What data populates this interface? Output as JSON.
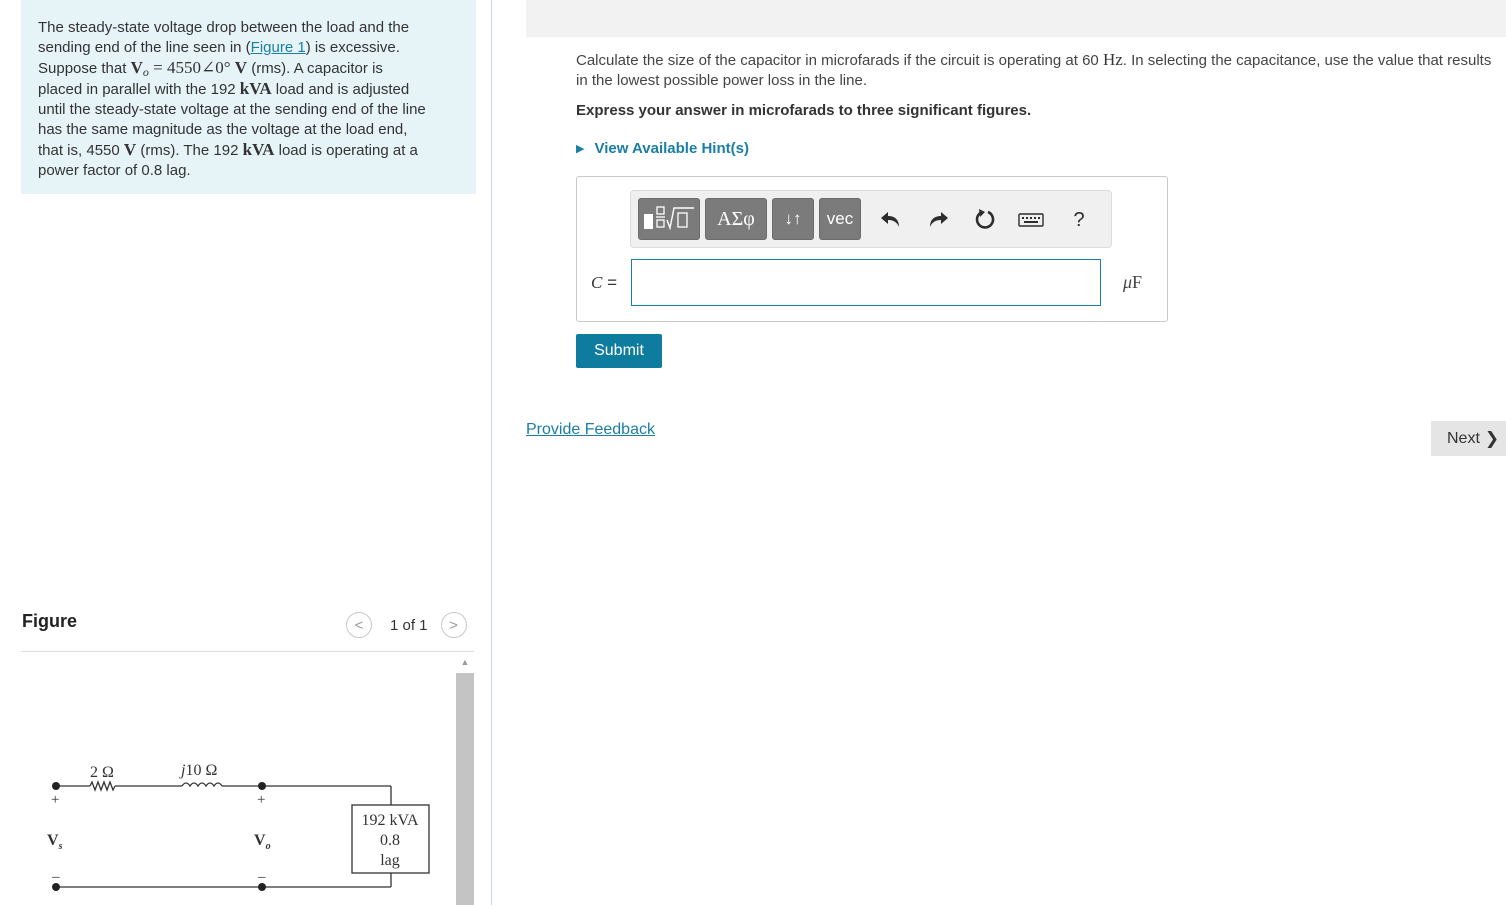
{
  "problem": {
    "lines": [
      [
        {
          "t": "The steady-state voltage drop between the load and the"
        }
      ],
      [
        {
          "t": "sending end of the line seen in ("
        },
        {
          "t": "Figure 1",
          "link": true
        },
        {
          "t": ") is excessive."
        }
      ],
      [
        {
          "t": "Suppose that "
        },
        {
          "t": "V",
          "m": true,
          "b": true
        },
        {
          "t": "o",
          "m": true,
          "i": true,
          "sub": true
        },
        {
          "t": " = 4550∠0° ",
          "m": true
        },
        {
          "t": "V",
          "m": true,
          "b": true
        },
        {
          "t": " (rms). A capacitor is"
        }
      ],
      [
        {
          "t": "placed in parallel with the 192 "
        },
        {
          "t": "kVA",
          "m": true,
          "b": true
        },
        {
          "t": " load and is adjusted"
        }
      ],
      [
        {
          "t": "until the steady-state voltage at the sending end of the line"
        }
      ],
      [
        {
          "t": "has the same magnitude as the voltage at the load end,"
        }
      ],
      [
        {
          "t": "that is, 4550 "
        },
        {
          "t": "V",
          "m": true,
          "b": true
        },
        {
          "t": " (rms). The 192 "
        },
        {
          "t": "kVA",
          "m": true,
          "b": true
        },
        {
          "t": " load is operating at a"
        }
      ],
      [
        {
          "t": "power factor of 0.8 lag."
        }
      ]
    ]
  },
  "figure": {
    "title": "Figure",
    "pager": {
      "prev": "<",
      "count": "1 of 1",
      "next": ">"
    },
    "circuit": {
      "resistor": "2 Ω",
      "inductor_j": "j",
      "inductor_val": "10 Ω",
      "vs": "V",
      "vs_sub": "s",
      "vo": "V",
      "vo_sub": "o",
      "plus": "+",
      "minus": "–",
      "load": [
        "192 kVA",
        "0.8",
        "lag"
      ]
    }
  },
  "question": {
    "text_before": "Calculate the size of the capacitor in microfarads if the circuit is operating at 60 ",
    "freq_unit": "Hz",
    "text_after": ". In selecting the capacitance, use the value that results in the lowest possible power loss in the line.",
    "instruction": "Express your answer in microfarads to three significant figures.",
    "hint_label": "View Available Hint(s)"
  },
  "answer": {
    "toolbar": {
      "greek": "ΑΣφ",
      "updown": "↓↑",
      "vec": "vec",
      "help": "?"
    },
    "var_label": "C",
    "equals": " =",
    "input_value": "",
    "unit_mu": "μ",
    "unit_f": "F",
    "submit": "Submit"
  },
  "footer": {
    "feedback": "Provide Feedback",
    "next": "Next"
  },
  "colors": {
    "accent": "#1a7ea6",
    "submit": "#0e7c9f",
    "problem_bg": "#e6f4f7"
  }
}
